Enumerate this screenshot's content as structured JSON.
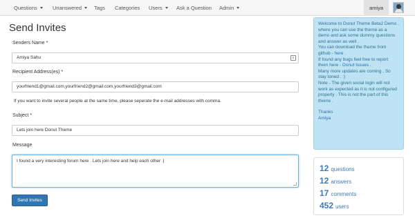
{
  "nav": {
    "items": [
      {
        "label": "Questions",
        "dropdown": true
      },
      {
        "label": "Unanswered",
        "dropdown": true
      },
      {
        "label": "Tags",
        "dropdown": false
      },
      {
        "label": "Categories",
        "dropdown": false
      },
      {
        "label": "Users",
        "dropdown": true
      },
      {
        "label": "Ask a Question",
        "dropdown": false
      },
      {
        "label": "Admin",
        "dropdown": true
      }
    ],
    "user": "amiya",
    "avatar_icon": "user-avatar-icon"
  },
  "form": {
    "title": "Send Invites",
    "sender_label": "Senders Name *",
    "sender_value": "Amiya Sahu",
    "recipient_label": "Recipient Address(es) *",
    "recipient_value": "yourfriend1@gmail.com,yourfriend2@gmail.com,yourfriend3@gmail.com",
    "recipient_help": "If you want to invite several people at the same time, please seperate the e-mail addresses with comma.",
    "subject_label": "Subject *",
    "subject_value": "Lets join here Donut Theme",
    "message_label": "Message",
    "message_value": "I found a very interesting forum here .  Lets join here and help each other .|",
    "submit_label": "Send Invites"
  },
  "sidebar": {
    "welcome": {
      "p1": "Welcome to Donut Theme Beta2 Demo , where you can use the theme as a demo and ask some dummy questions and answer as well .",
      "p2_text": "You can download the theme from github - ",
      "p2_link": "here",
      "p2_tail": " .",
      "p3_text": "If found any bugs feel free to report them here - ",
      "p3_link": "Donut Issues",
      "p3_tail": " .",
      "p4": "Many more updates are coming , So stay toned . :)",
      "p5": "Note - The given social login will not work as expected as it is not configured properly . This is not the part of this theme .",
      "thanks": "Thanks",
      "signature": "Amiya"
    },
    "stats": [
      {
        "value": "12",
        "label": "questions"
      },
      {
        "value": "12",
        "label": "answers"
      },
      {
        "value": "17",
        "label": "comments"
      },
      {
        "value": "452",
        "label": "users"
      }
    ]
  },
  "colors": {
    "primary_button": "#3276b1",
    "info_panel": "#bde3f5",
    "stat_text": "#3c7ab8"
  }
}
